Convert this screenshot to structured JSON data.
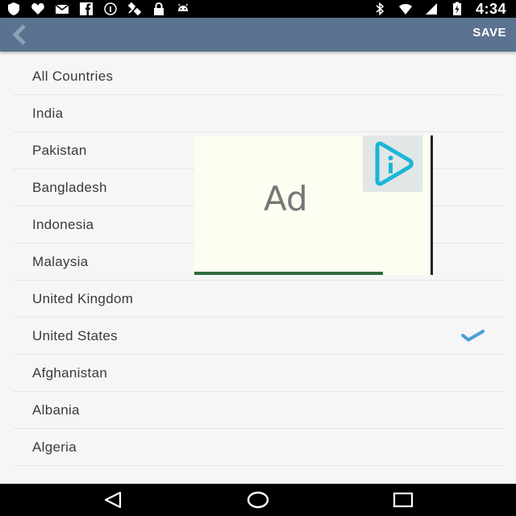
{
  "status_bar": {
    "time": "4:34",
    "left_icons": [
      "shield-icon",
      "heart-icon",
      "mail-icon",
      "facebook-icon",
      "info-circle-icon",
      "satellite-icon",
      "lock-icon",
      "android-icon"
    ],
    "right_icons": [
      "bluetooth-icon",
      "wifi-icon",
      "signal-icon",
      "battery-icon"
    ]
  },
  "action_bar": {
    "save_label": "SAVE",
    "color": "#5b7290"
  },
  "countries": [
    {
      "label": "All Countries",
      "selected": false
    },
    {
      "label": "India",
      "selected": false
    },
    {
      "label": "Pakistan",
      "selected": false
    },
    {
      "label": "Bangladesh",
      "selected": false
    },
    {
      "label": "Indonesia",
      "selected": false
    },
    {
      "label": "Malaysia",
      "selected": false
    },
    {
      "label": "United Kingdom",
      "selected": false
    },
    {
      "label": "United States",
      "selected": true
    },
    {
      "label": "Afghanistan",
      "selected": false
    },
    {
      "label": "Albania",
      "selected": false
    },
    {
      "label": "Algeria",
      "selected": false
    }
  ],
  "ad": {
    "label": "Ad",
    "icon": "play-info-icon"
  },
  "nav_bar": {
    "icons": [
      "back-triangle-icon",
      "home-circle-icon",
      "recents-square-icon"
    ]
  },
  "colors": {
    "check": "#4a9fd8",
    "ad_icon": "#1bb6d8"
  }
}
